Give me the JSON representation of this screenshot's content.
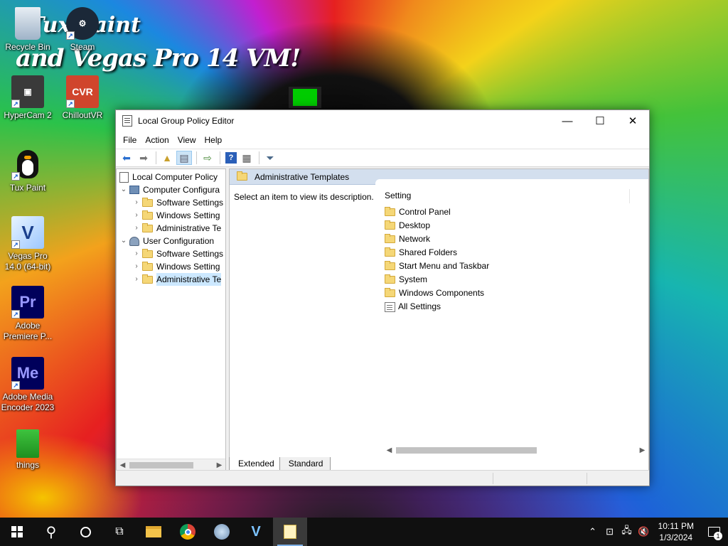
{
  "desktop": {
    "banner_top": "Tux Paint",
    "banner": "and Vegas Pro 14 VM!",
    "icons": [
      {
        "label": "Recycle Bin"
      },
      {
        "label": "Steam"
      },
      {
        "label": "HyperCam 2"
      },
      {
        "label": "ChilloutVR"
      },
      {
        "label": "Tux Paint"
      },
      {
        "label": "Vegas Pro 14.0 (64-bit)"
      },
      {
        "label": "Adobe Premiere P...",
        "glyph": "Pr"
      },
      {
        "label": "Adobe Media Encoder 2023",
        "glyph": "Me"
      },
      {
        "label": "things"
      }
    ]
  },
  "window": {
    "title": "Local Group Policy Editor",
    "controls": {
      "minimize": "—",
      "maximize": "☐",
      "close": "✕"
    },
    "menu": [
      "File",
      "Action",
      "View",
      "Help"
    ],
    "tree": {
      "root": "Local Computer Policy",
      "computer": "Computer Configura",
      "computer_children": [
        "Software Settings",
        "Windows Setting",
        "Administrative Te"
      ],
      "user": "User Configuration",
      "user_children": [
        "Software Settings",
        "Windows Setting",
        "Administrative Te"
      ]
    },
    "right": {
      "header": "Administrative Templates",
      "description": "Select an item to view its description.",
      "column_header": "Setting",
      "items": [
        "Control Panel",
        "Desktop",
        "Network",
        "Shared Folders",
        "Start Menu and Taskbar",
        "System",
        "Windows Components",
        "All Settings"
      ]
    },
    "tabs": [
      "Extended",
      "Standard"
    ]
  },
  "taskbar": {
    "time": "10:11 PM",
    "date": "1/3/2024",
    "notification_count": "1"
  }
}
